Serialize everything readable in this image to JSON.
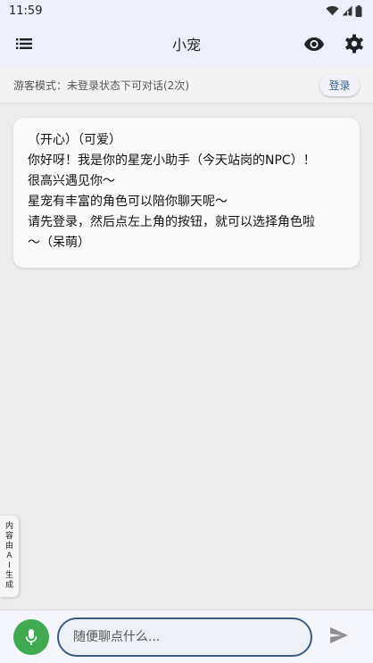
{
  "status_bar": {
    "time": "11:59"
  },
  "app_bar": {
    "title": "小宠"
  },
  "guest_notice": {
    "text": "游客模式：未登录状态下可对话(2次)",
    "login_label": "登录"
  },
  "chat": {
    "messages": [
      {
        "role": "assistant",
        "lines": [
          "（开心）（可爱）",
          "你好呀！我是你的星宠小助手（今天站岗的NPC）！",
          "很高兴遇见你～",
          "星宠有丰富的角色可以陪你聊天呢～",
          "请先登录，然后点左上角的按钮，就可以选择角色啦",
          "～（呆萌）"
        ]
      }
    ]
  },
  "ai_tag": {
    "chars": [
      "内",
      "容",
      "由",
      "A",
      "I",
      "生",
      "成"
    ]
  },
  "input_bar": {
    "placeholder": "随便聊点什么..."
  },
  "colors": {
    "header_bg": "#edf0fb",
    "page_bg": "#ececec",
    "mic_green": "#3faa4f",
    "input_border": "#3d5a80",
    "login_text": "#3a5f95"
  },
  "icons": {
    "menu": "list-icon",
    "visibility": "eye-icon",
    "settings": "gear-icon",
    "mic": "mic-icon",
    "send": "send-icon",
    "wifi": "wifi-icon",
    "signal": "signal-icon",
    "battery": "battery-icon"
  }
}
